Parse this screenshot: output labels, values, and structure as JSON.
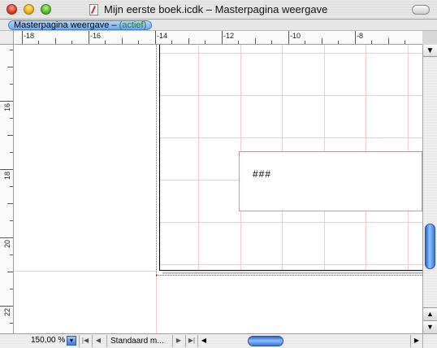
{
  "window": {
    "title": "Mijn eerste boek.icdk – Masterpagina weergave",
    "document_icon": "document-icon"
  },
  "tab": {
    "label": "Masterpagina weergave – ",
    "status": "(actief)"
  },
  "rulers": {
    "horizontal_labels": [
      "-18",
      "-16",
      "-14",
      "-12",
      "-10",
      "-8"
    ],
    "vertical_labels": [
      "16",
      "18",
      "20",
      "22"
    ]
  },
  "canvas": {
    "frame_text": "###"
  },
  "bottom": {
    "zoom": "150,00 %",
    "page_name": "Standaard m...",
    "first_icon": "first-page-icon",
    "prev_icon": "previous-page-icon",
    "next_icon": "next-page-icon",
    "last_icon": "last-page-icon"
  },
  "scroll": {
    "vertical_position": 0.62,
    "horizontal_position": 0.25
  }
}
